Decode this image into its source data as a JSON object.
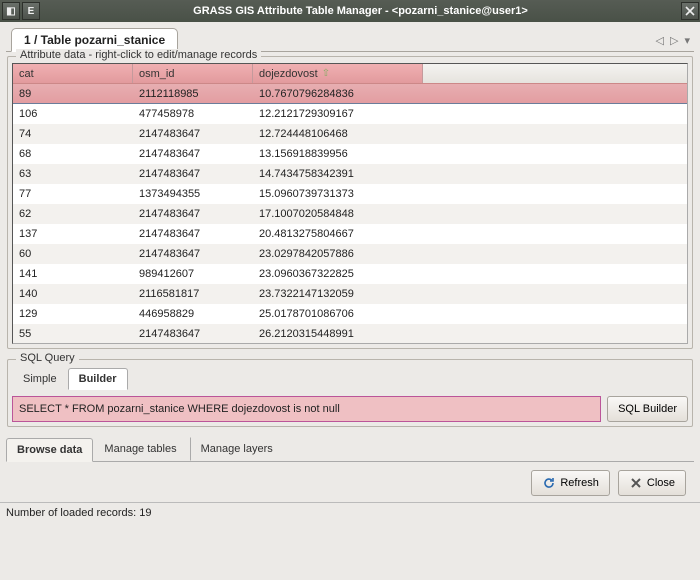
{
  "window": {
    "title": "GRASS GIS Attribute Table Manager - <pozarni_stanice@user1>",
    "file_tab": "1 / Table pozarni_stanice"
  },
  "attribute_panel": {
    "legend": "Attribute data - right-click to edit/manage records",
    "columns": {
      "c1": "cat",
      "c2": "osm_id",
      "c3": "dojezdovost"
    },
    "rows": [
      {
        "cat": "89",
        "osm_id": "2112118985",
        "doj": "10.7670796284836",
        "selected": true
      },
      {
        "cat": "106",
        "osm_id": "477458978",
        "doj": "12.2121729309167"
      },
      {
        "cat": "74",
        "osm_id": "2147483647",
        "doj": "12.724448106468"
      },
      {
        "cat": "68",
        "osm_id": "2147483647",
        "doj": "13.156918839956"
      },
      {
        "cat": "63",
        "osm_id": "2147483647",
        "doj": "14.7434758342391"
      },
      {
        "cat": "77",
        "osm_id": "1373494355",
        "doj": "15.0960739731373"
      },
      {
        "cat": "62",
        "osm_id": "2147483647",
        "doj": "17.1007020584848"
      },
      {
        "cat": "137",
        "osm_id": "2147483647",
        "doj": "20.4813275804667"
      },
      {
        "cat": "60",
        "osm_id": "2147483647",
        "doj": "23.0297842057886"
      },
      {
        "cat": "141",
        "osm_id": "989412607",
        "doj": "23.0960367322825"
      },
      {
        "cat": "140",
        "osm_id": "2116581817",
        "doj": "23.7322147132059"
      },
      {
        "cat": "129",
        "osm_id": "446958829",
        "doj": "25.0178701086706"
      },
      {
        "cat": "55",
        "osm_id": "2147483647",
        "doj": "26.2120315448991"
      }
    ]
  },
  "sql_panel": {
    "legend": "SQL Query",
    "tabs": {
      "simple": "Simple",
      "builder": "Builder"
    },
    "query": "SELECT * FROM pozarni_stanice WHERE dojezdovost is not null",
    "builder_btn": "SQL Builder"
  },
  "bottom_tabs": {
    "browse": "Browse data",
    "manage_tables": "Manage tables",
    "manage_layers": "Manage layers"
  },
  "buttons": {
    "refresh": "Refresh",
    "close": "Close"
  },
  "status": "Number of loaded records: 19"
}
